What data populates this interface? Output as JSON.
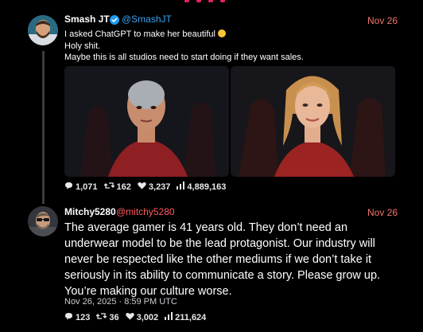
{
  "colors": {
    "background": "#000000",
    "accent_handle_1": "#3aa3f0",
    "accent_handle_2": "#ff5a5f",
    "date": "#f1736a",
    "text": "#ffffff"
  },
  "post1": {
    "author_name": "Smash JT",
    "verified_icon": "verified-badge-icon",
    "handle": "@SmashJT",
    "date": "Nov 26",
    "line1": "I asked ChatGPT to make her beautiful",
    "emoji_icon": "laughing-emoji-icon",
    "line2": "Holy shit.",
    "line3": "Maybe this is all studios need to start doing if they want sales.",
    "stats": {
      "replies": "1,071",
      "retweets": "162",
      "likes": "3,237",
      "views": "4,889,163"
    }
  },
  "post2": {
    "author_name": "Mitchy5280",
    "handle": "@mitchy5280",
    "date": "Nov 26",
    "body_lines": [
      "The average gamer is 41 years old. They don’t need an",
      "underwear model to be the lead protagonist. Our industry will",
      "never be respected like the other mediums if we don’t take it",
      "seriously in its ability to communicate a story. Please grow up.",
      "You’re making our culture worse."
    ],
    "timestamp": "Nov 26, 2025 · 8:59 PM UTC",
    "stats": {
      "replies": "123",
      "retweets": "36",
      "likes": "3,002",
      "views": "211,624"
    }
  }
}
